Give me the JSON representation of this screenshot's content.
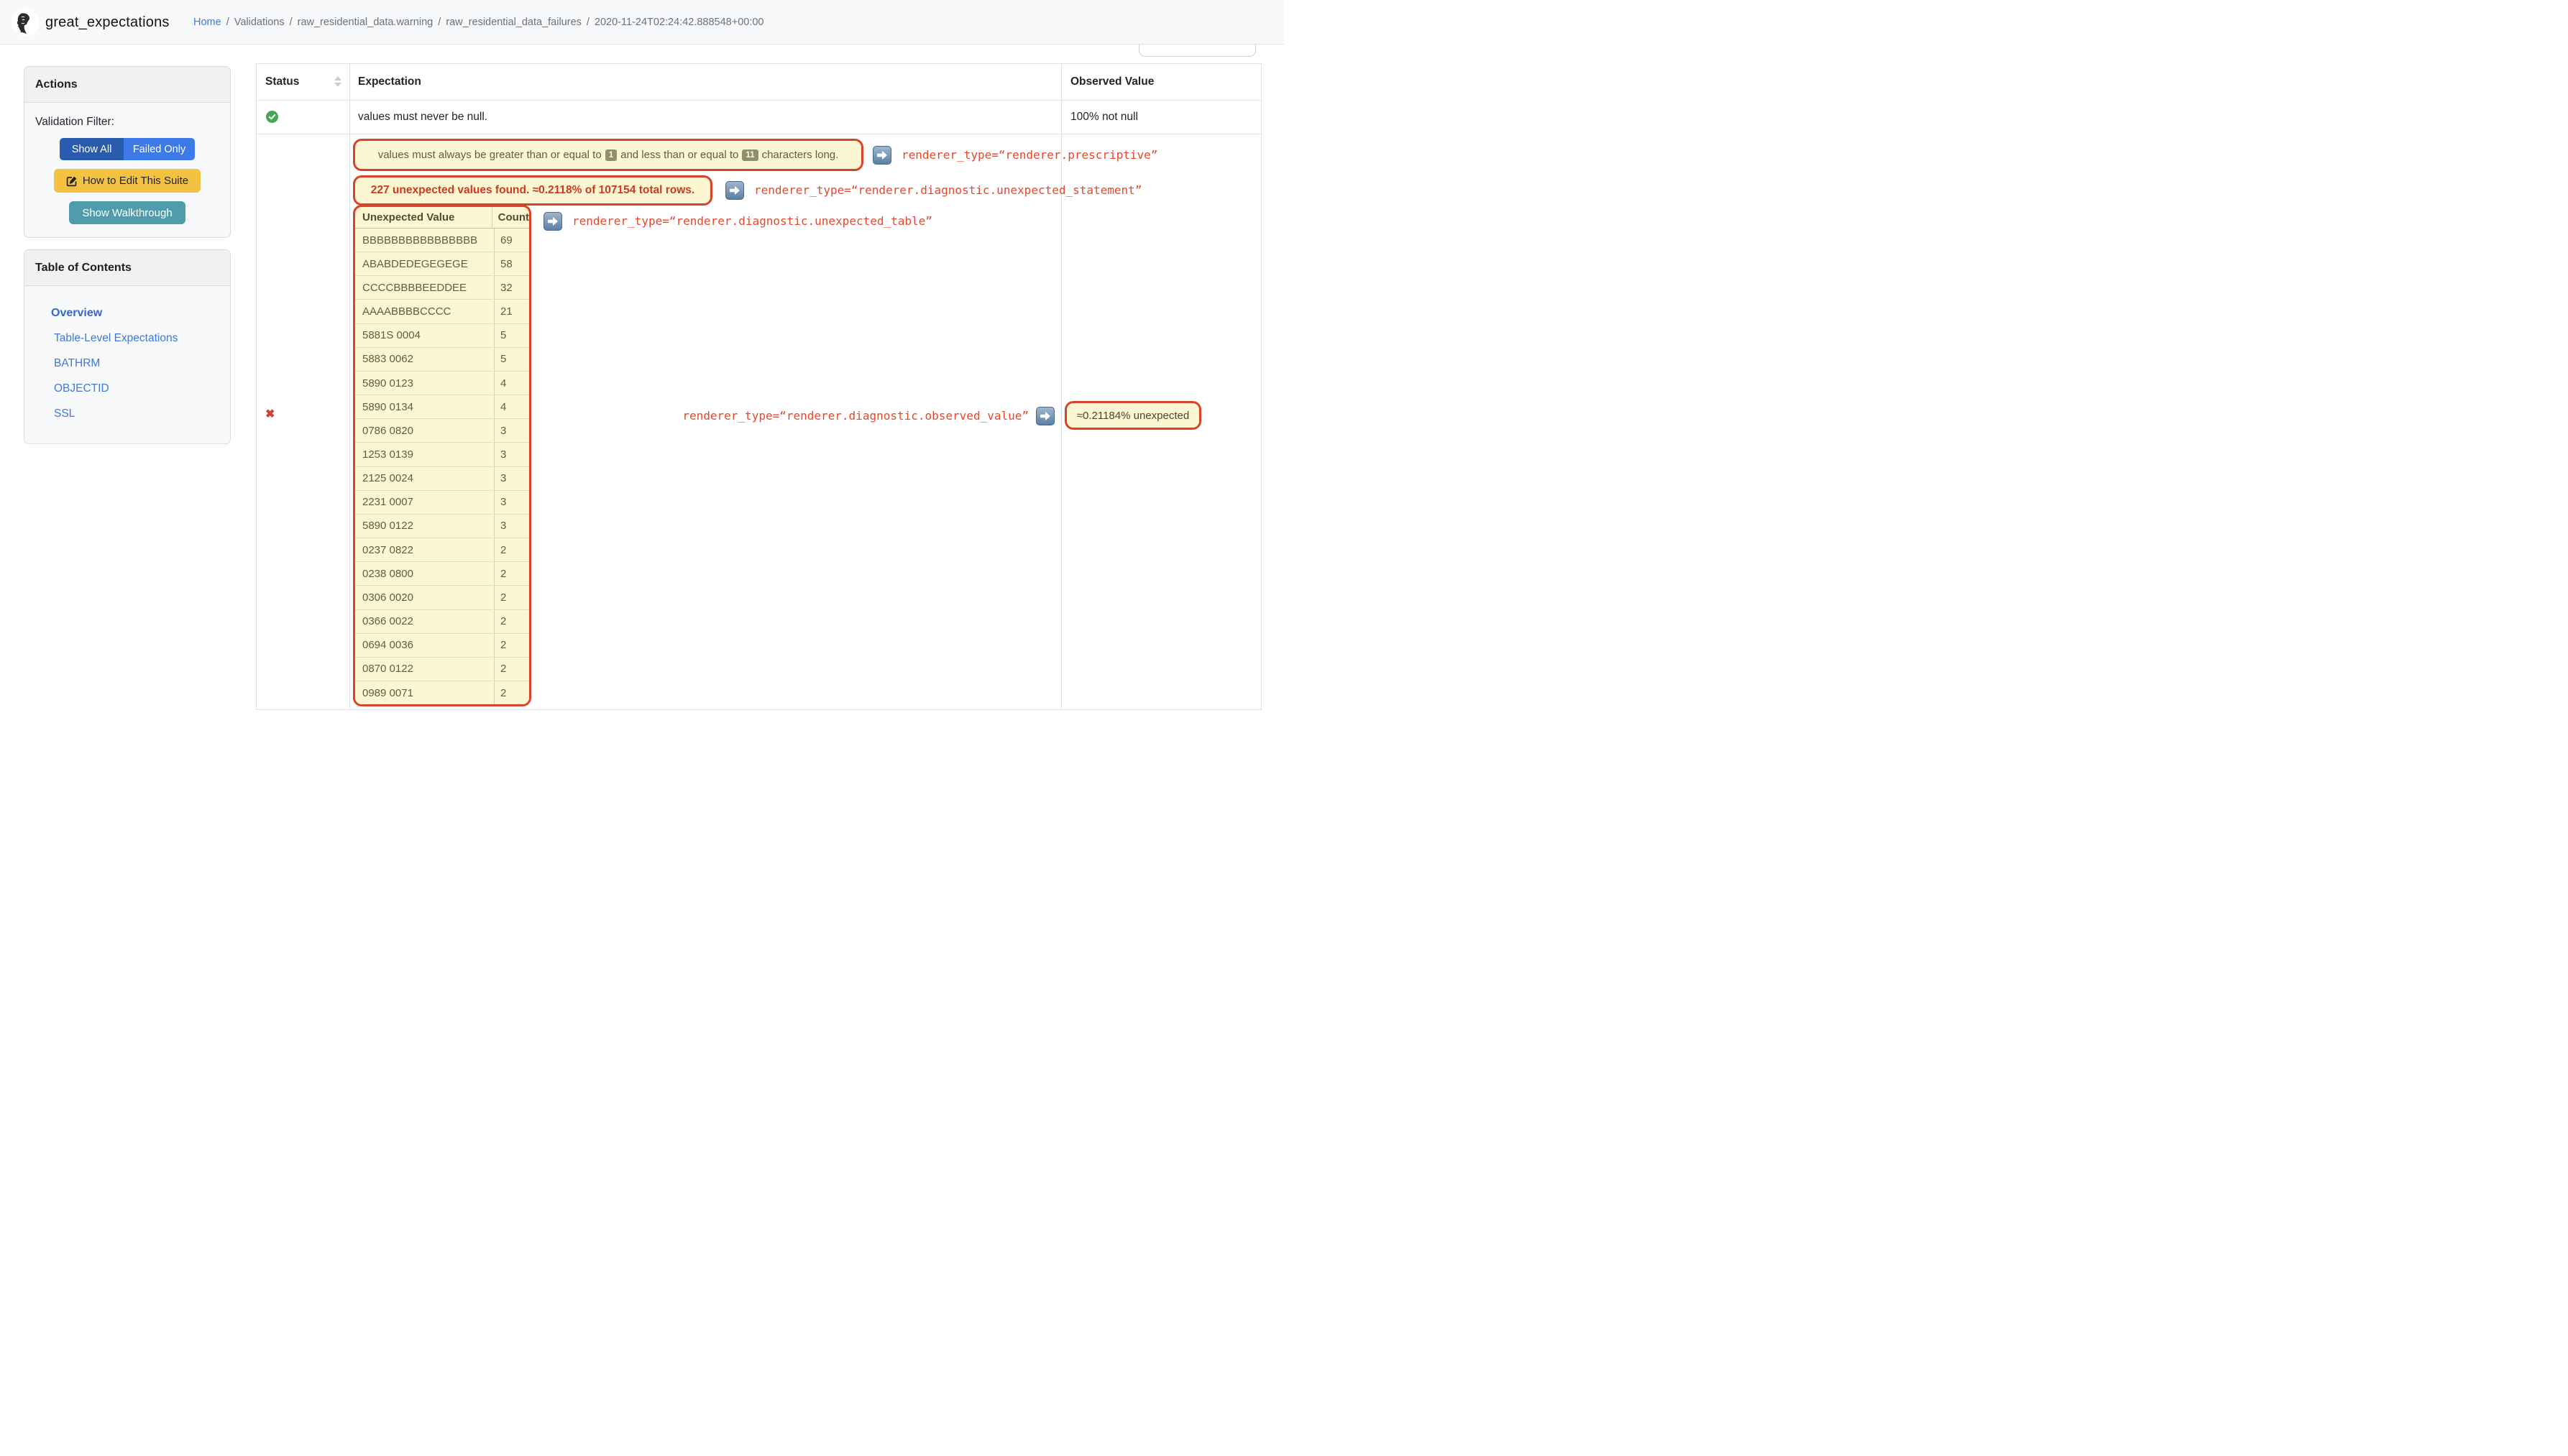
{
  "header": {
    "brand": "great_expectations",
    "breadcrumb": {
      "home": "Home",
      "separator": "/",
      "items": [
        "Validations",
        "raw_residential_data.warning",
        "raw_residential_data_failures",
        "2020-11-24T02:24:42.888548+00:00"
      ]
    }
  },
  "sidebar": {
    "actions": {
      "title": "Actions",
      "filter_label": "Validation Filter:",
      "show_all": "Show All",
      "failed_only": "Failed Only",
      "edit_suite": "How to Edit This Suite",
      "walkthrough": "Show Walkthrough"
    },
    "toc": {
      "title": "Table of Contents",
      "items": [
        "Overview",
        "Table-Level Expectations",
        "BATHRM",
        "OBJECTID",
        "SSL"
      ],
      "active_item": "Overview"
    }
  },
  "table": {
    "columns": {
      "status": "Status",
      "expectation": "Expectation",
      "observed": "Observed Value"
    },
    "passed_row": {
      "status": "passed",
      "expectation": "values must never be null.",
      "observed": "100% not null"
    },
    "failed_row": {
      "status": "failed",
      "prescriptive": {
        "text_before": "values must always be greater than or equal to",
        "min": "1",
        "text_mid": "and less than or equal to",
        "max": "11",
        "text_after": "characters long.",
        "annotation": "renderer_type=“renderer.prescriptive”"
      },
      "unexpected_statement": {
        "text": "227 unexpected values found. ≈0.2118% of 107154 total rows.",
        "annotation": "renderer_type=“renderer.diagnostic.unexpected_statement”"
      },
      "unexpected_table": {
        "annotation": "renderer_type=“renderer.diagnostic.unexpected_table”",
        "headers": [
          "Unexpected Value",
          "Count"
        ],
        "rows": [
          [
            "BBBBBBBBBBBBBBBB",
            "69"
          ],
          [
            "ABABDEDEGEGEGE",
            "58"
          ],
          [
            "CCCCBBBBEEDDEE",
            "32"
          ],
          [
            "AAAABBBBCCCC",
            "21"
          ],
          [
            "5881S 0004",
            "5"
          ],
          [
            "5883 0062",
            "5"
          ],
          [
            "5890 0123",
            "4"
          ],
          [
            "5890 0134",
            "4"
          ],
          [
            "0786 0820",
            "3"
          ],
          [
            "1253 0139",
            "3"
          ],
          [
            "2125 0024",
            "3"
          ],
          [
            "2231 0007",
            "3"
          ],
          [
            "5890 0122",
            "3"
          ],
          [
            "0237 0822",
            "2"
          ],
          [
            "0238 0800",
            "2"
          ],
          [
            "0306 0020",
            "2"
          ],
          [
            "0366 0022",
            "2"
          ],
          [
            "0694 0036",
            "2"
          ],
          [
            "0870 0122",
            "2"
          ],
          [
            "0989 0071",
            "2"
          ]
        ]
      },
      "observed_value": {
        "annotation": "renderer_type=“renderer.diagnostic.observed_value”",
        "value": "≈0.21184% unexpected"
      }
    }
  },
  "colors": {
    "annotation_border": "#d8432a",
    "annotation_bg": "#fcf7d2",
    "annotation_text_olive": "#5f5f40",
    "annotation_text_red": "#cb3927",
    "mono_red": "#e8472b",
    "primary_active": "#2b5bac",
    "primary": "#3d7ae8",
    "warning": "#f3c243",
    "teal": "#4f9dac",
    "success": "#49a45c",
    "fail": "#c64242",
    "link": "#3d78e2"
  }
}
